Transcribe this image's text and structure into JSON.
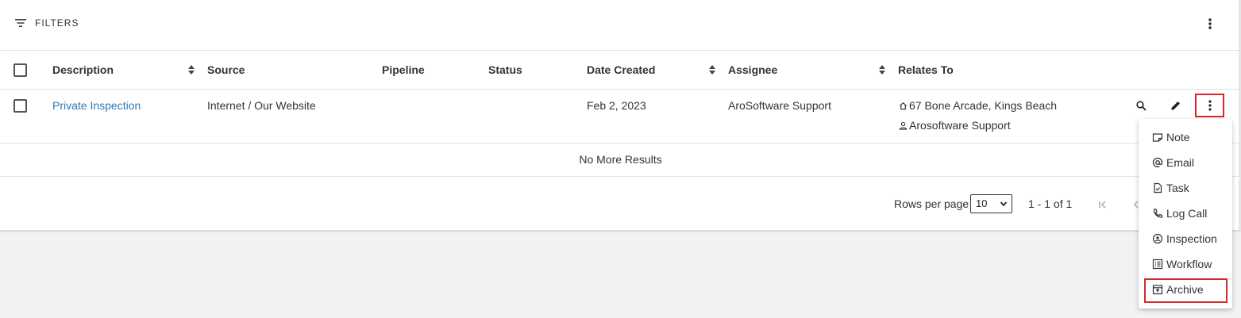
{
  "toolbar": {
    "filters_label": "FILTERS",
    "filter_icon": "filter-list-icon",
    "more_icon": "more-vert-icon"
  },
  "table": {
    "columns": [
      "Description",
      "Source",
      "Pipeline",
      "Status",
      "Date Created",
      "Assignee",
      "Relates To"
    ],
    "rows": [
      {
        "description": "Private Inspection",
        "source": "Internet / Our Website",
        "pipeline": "",
        "status": "",
        "date_created": "Feb 2, 2023",
        "assignee": "AroSoftware Support",
        "relates_to": [
          {
            "icon": "home-icon",
            "text": "67 Bone Arcade, Kings Beach"
          },
          {
            "icon": "person-icon",
            "text": "Arosoftware Support"
          }
        ],
        "actions": [
          "search-icon",
          "edit-icon",
          "more-vert-icon"
        ]
      }
    ],
    "footer_text": "No More Results"
  },
  "pagination": {
    "rows_per_page_label": "Rows per page",
    "rows_per_page_value": "10",
    "range_text": "1 - 1 of 1"
  },
  "context_menu": {
    "items": [
      {
        "label": "Note",
        "icon": "note-icon"
      },
      {
        "label": "Email",
        "icon": "at-sign-icon"
      },
      {
        "label": "Task",
        "icon": "task-icon"
      },
      {
        "label": "Log Call",
        "icon": "phone-icon"
      },
      {
        "label": "Inspection",
        "icon": "location-pin-icon"
      },
      {
        "label": "Workflow",
        "icon": "list-icon"
      },
      {
        "label": "Archive",
        "icon": "archive-icon"
      }
    ]
  },
  "colors": {
    "link": "#2a7ab8",
    "highlight": "#d9262c",
    "page_background": "#f2f2f2"
  }
}
